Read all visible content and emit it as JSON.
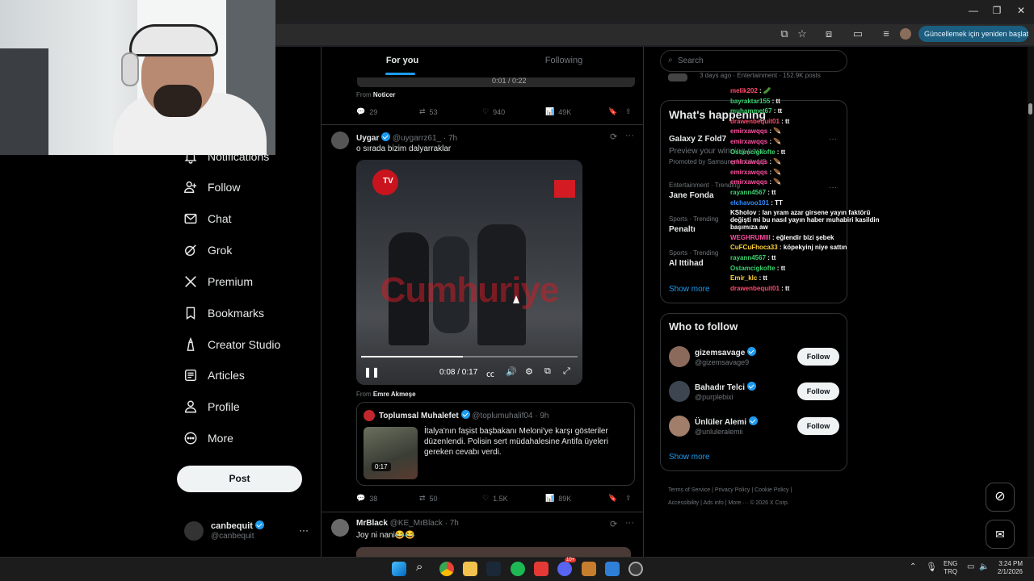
{
  "browser": {
    "update_label": "Güncellemek için yeniden başlat",
    "update_menu": "⋮"
  },
  "tabs": [
    {
      "label": "For you",
      "active": true
    },
    {
      "label": "Following",
      "active": false
    }
  ],
  "sidebar": {
    "items": [
      {
        "label": "Notifications",
        "icon": "bell-icon"
      },
      {
        "label": "Follow",
        "icon": "person-add-icon"
      },
      {
        "label": "Chat",
        "icon": "mail-icon"
      },
      {
        "label": "Grok",
        "icon": "grok-icon"
      },
      {
        "label": "Premium",
        "icon": "x-logo-icon"
      },
      {
        "label": "Bookmarks",
        "icon": "bookmark-icon"
      },
      {
        "label": "Creator Studio",
        "icon": "creator-icon"
      },
      {
        "label": "Articles",
        "icon": "article-icon"
      },
      {
        "label": "Profile",
        "icon": "person-icon"
      },
      {
        "label": "More",
        "icon": "more-circle-icon"
      }
    ],
    "post_label": "Post",
    "account": {
      "name": "canbequit",
      "handle": "@canbequit",
      "more": "···"
    }
  },
  "feed": {
    "top_post": {
      "video_time": "0:01 / 0:22",
      "from_prefix": "From",
      "from_name": "Noticer",
      "replies": "29",
      "reposts": "53",
      "likes": "940",
      "views": "49K"
    },
    "post1": {
      "name": "Uygar",
      "handle_time": "@uygarrz61_ · 7h",
      "text": "o sırada bizim dalyarraklar",
      "video_watermark": "Cumhuriye",
      "video_time": "0:08 / 0:17",
      "video_progress": 0.47,
      "from_prefix": "From",
      "from_name": "Emre Akmeşe",
      "quote": {
        "name": "Toplumsal Muhalefet",
        "handle_time": "@toplumuhalif04 · 9h",
        "text": "İtalya'nın faşist başbakanı Meloni'ye karşı gösteriler düzenlendi. Polisin sert müdahalesine Antifa üyeleri gereken cevabı verdi.",
        "duration": "0:17"
      },
      "replies": "38",
      "reposts": "50",
      "likes": "1.5K",
      "views": "89K"
    },
    "post2": {
      "name": "MrBlack",
      "handle_time": "@KE_MrBlack · 7h",
      "text": "Joy ni nani😂😂"
    }
  },
  "right": {
    "search_placeholder": "Search",
    "top_meta": "3 days ago · Entertainment · 152.9K posts",
    "happening_title": "What's happening",
    "trends": [
      {
        "meta": "",
        "title": "Galaxy Z Fold7",
        "subtitle": "Preview your winning pose",
        "promo": "Promoted by Samsung Mobile US"
      },
      {
        "meta": "Entertainment · Trending",
        "title": "Jane Fonda"
      },
      {
        "meta": "Sports · Trending",
        "title": "Penaltı"
      },
      {
        "meta": "Sports · Trending",
        "title": "Al Ittihad"
      }
    ],
    "show_more": "Show more",
    "who_to_follow_title": "Who to follow",
    "follow_suggestions": [
      {
        "name": "gizemsavage",
        "handle": "@gizemsavage9",
        "button": "Follow"
      },
      {
        "name": "Bahadır Telci",
        "handle": "@purplebixi",
        "button": "Follow"
      },
      {
        "name": "Ünlüler Alemi",
        "handle": "@unluleralemii",
        "button": "Follow"
      }
    ],
    "show_more_2": "Show more",
    "footer": [
      "Terms of Service",
      "Privacy Policy",
      "Cookie Policy",
      "Accessibility",
      "Ads info",
      "More ···",
      "© 2026 X Corp."
    ]
  },
  "chat_overlay": [
    {
      "user": "melik202",
      "msg": "🥒",
      "color": "#ff4d6d"
    },
    {
      "user": "bayraktar155",
      "msg": "tt",
      "color": "#3bd16f"
    },
    {
      "user": "muhammet67",
      "msg": "tt",
      "color": "#3bd16f"
    },
    {
      "user": "drawenbequit01",
      "msg": "tt",
      "color": "#ff4d6d"
    },
    {
      "user": "emirxawqqs",
      "msg": "🪶",
      "color": "#ff4fa0"
    },
    {
      "user": "emirxawqqs",
      "msg": "🪶",
      "color": "#ff4fa0"
    },
    {
      "user": "Ostamcigkofte",
      "msg": "tt",
      "color": "#3bd16f"
    },
    {
      "user": "emirxawqqs",
      "msg": "🪶",
      "color": "#ff4fa0"
    },
    {
      "user": "emirxawqqs",
      "msg": "🪶",
      "color": "#ff4fa0"
    },
    {
      "user": "emirxawqqs",
      "msg": "🪶",
      "color": "#ff4fa0"
    },
    {
      "user": "rayann4567",
      "msg": "tt",
      "color": "#3bd16f"
    },
    {
      "user": "elchavoo101",
      "msg": "TT",
      "color": "#2e8bff"
    },
    {
      "user": "KSholov",
      "msg": "lan yram azar girsene yayın faktörü değişti mi bu nasıl yayın haber muhabiri kasildin başımıza aw",
      "color": "#ffffff"
    },
    {
      "user": "WEGHRUMIII",
      "msg": "eğlendir bizi şebek",
      "color": "#ff4fa0"
    },
    {
      "user": "CuFCuFhoca33",
      "msg": "köpekyinj niye sattın",
      "color": "#ffd23b"
    },
    {
      "user": "rayann4567",
      "msg": "tt",
      "color": "#3bd16f"
    },
    {
      "user": "Ostamcigkofte",
      "msg": "tt",
      "color": "#3bd16f"
    },
    {
      "user": "Emir_klc",
      "msg": "tt",
      "color": "#ffd23b"
    },
    {
      "user": "drawenbequit01",
      "msg": "tt",
      "color": "#ff4d6d"
    }
  ],
  "taskbar": {
    "lang_top": "ENG",
    "lang_bottom": "TRQ",
    "time": "3:24 PM",
    "date": "2/1/2026",
    "discord_badge": "10+"
  }
}
